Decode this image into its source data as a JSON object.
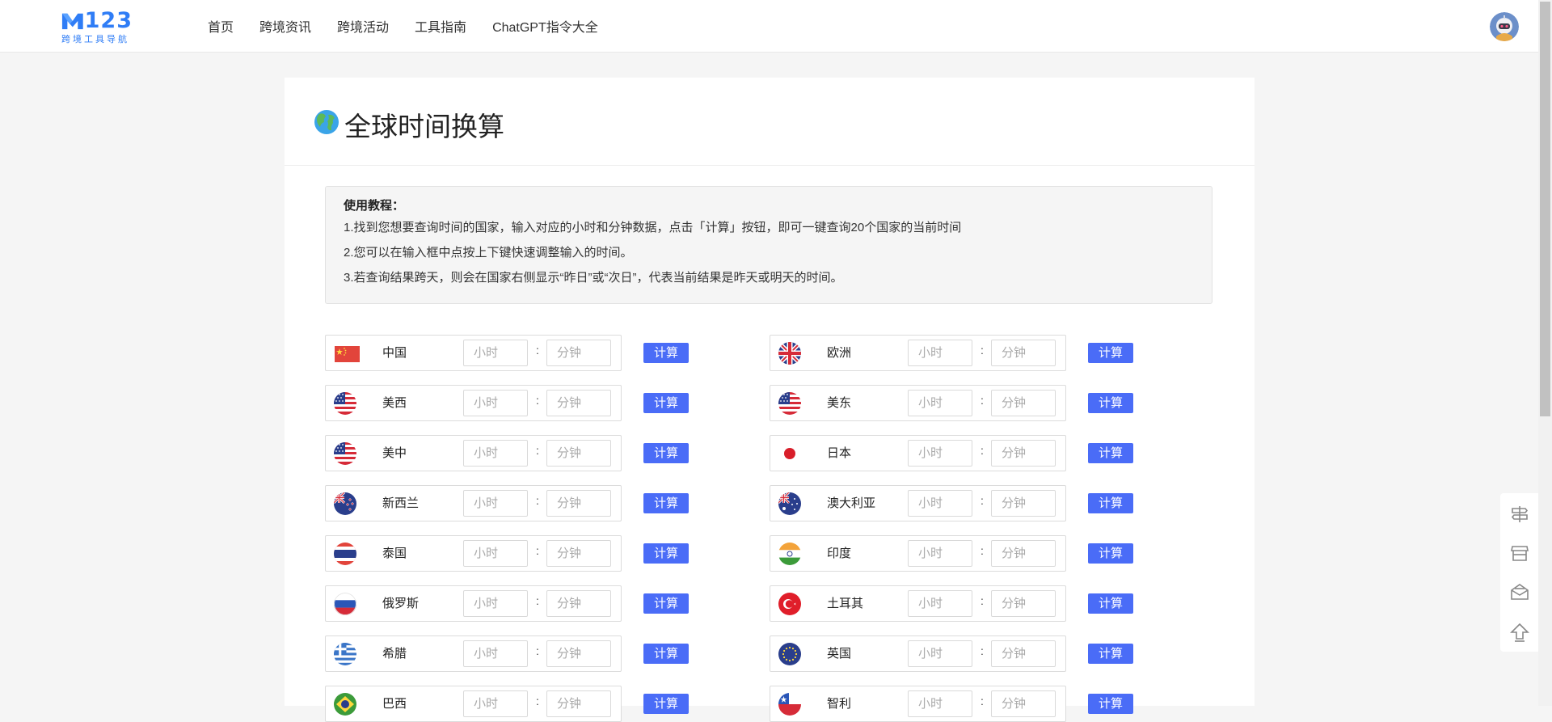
{
  "header": {
    "logo_main": "123",
    "logo_sub": "跨境工具导航",
    "nav": [
      "首页",
      "跨境资讯",
      "跨境活动",
      "工具指南",
      "ChatGPT指令大全"
    ]
  },
  "page": {
    "title": "全球时间换算",
    "guide_title": "使用教程：",
    "guide_lines": [
      "1.找到您想要查询时间的国家，输入对应的小时和分钟数据，点击「计算」按钮，即可一键查询20个国家的当前时间",
      "2.您可以在输入框中点按上下键快速调整输入的时间。",
      "3.若查询结果跨天，则会在国家右侧显示“昨日”或“次日”，代表当前结果是昨天或明天的时间。"
    ]
  },
  "form": {
    "hour_placeholder": "小时",
    "minute_placeholder": "分钟",
    "separator": ":",
    "calc_label": "计算"
  },
  "countries": [
    {
      "name": "中国",
      "flag": "china-flag"
    },
    {
      "name": "欧洲",
      "flag": "uk-flag"
    },
    {
      "name": "美西",
      "flag": "usa-flag"
    },
    {
      "name": "美东",
      "flag": "usa-flag"
    },
    {
      "name": "美中",
      "flag": "usa-flag"
    },
    {
      "name": "日本",
      "flag": "japan-flag"
    },
    {
      "name": "新西兰",
      "flag": "new-zealand-flag"
    },
    {
      "name": "澳大利亚",
      "flag": "australia-flag"
    },
    {
      "name": "泰国",
      "flag": "thailand-flag"
    },
    {
      "name": "印度",
      "flag": "india-flag"
    },
    {
      "name": "俄罗斯",
      "flag": "russia-flag"
    },
    {
      "name": "土耳其",
      "flag": "turkey-flag"
    },
    {
      "name": "希腊",
      "flag": "greece-flag"
    },
    {
      "name": "英国",
      "flag": "eu-flag"
    },
    {
      "name": "巴西",
      "flag": "brazil-flag"
    },
    {
      "name": "智利",
      "flag": "chile-flag"
    }
  ],
  "sidebar_tools": [
    "signpost-icon",
    "store-icon",
    "mail-open-icon",
    "back-to-top-icon"
  ],
  "colors": {
    "accent": "#4a6cf7",
    "brand": "#2f7df6",
    "page_bg": "#f5f5f5"
  }
}
